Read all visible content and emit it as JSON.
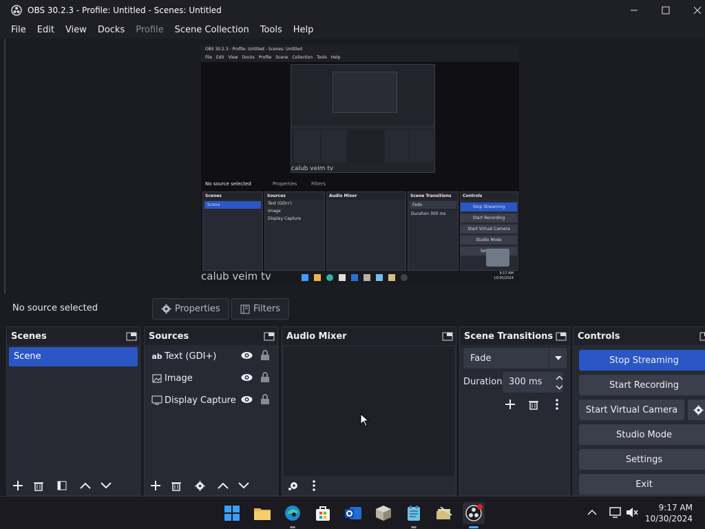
{
  "window": {
    "title": "OBS 30.2.3 - Profile: Untitled - Scenes: Untitled"
  },
  "menu": [
    {
      "label": "File",
      "enabled": true
    },
    {
      "label": "Edit",
      "enabled": true
    },
    {
      "label": "View",
      "enabled": true
    },
    {
      "label": "Docks",
      "enabled": true
    },
    {
      "label": "Profile",
      "enabled": false
    },
    {
      "label": "Scene Collection",
      "enabled": true
    },
    {
      "label": "Tools",
      "enabled": true
    },
    {
      "label": "Help",
      "enabled": true
    }
  ],
  "preview": {
    "caption": "calub veim tv",
    "inner_title": "OBS 30.2.3 - Profile: Untitled - Scenes: Untitled",
    "inner_menu": "File Edit View Docks Profile Scene Collection Tools Help",
    "inner_no_source": "No source selected",
    "inner_properties": "Properties",
    "inner_filters": "Filters",
    "inner_panels": {
      "scenes": "Scenes",
      "sources": "Sources",
      "mixer": "Audio Mixer",
      "transitions": "Scene Transitions",
      "controls": "Controls"
    },
    "inner_scene": "Scene",
    "inner_sources": [
      "Text (GDI+)",
      "Image",
      "Display Capture"
    ],
    "inner_fade": "Fade",
    "inner_duration": "Duration",
    "inner_duration_value": "300 ms",
    "inner_buttons": [
      "Stop Streaming",
      "Start Recording",
      "Start Virtual Camera",
      "Studio Mode",
      "Settings"
    ],
    "inner_clock_time": "9:17 AM",
    "inner_clock_date": "10/30/2024"
  },
  "properties_bar": {
    "status": "No source selected",
    "properties_label": "Properties",
    "filters_label": "Filters"
  },
  "docks": {
    "scenes": {
      "title": "Scenes",
      "items": [
        "Scene"
      ]
    },
    "sources": {
      "title": "Sources",
      "items": [
        {
          "label": "Text (GDI+)",
          "icon": "text-icon"
        },
        {
          "label": "Image",
          "icon": "image-icon"
        },
        {
          "label": "Display Capture",
          "icon": "monitor-icon"
        }
      ]
    },
    "mixer": {
      "title": "Audio Mixer"
    },
    "transitions": {
      "title": "Scene Transitions",
      "selected": "Fade",
      "duration_label": "Duration",
      "duration_value": "300 ms"
    },
    "controls": {
      "title": "Controls",
      "buttons": {
        "stop_streaming": "Stop Streaming",
        "start_recording": "Start Recording",
        "start_virtual_camera": "Start Virtual Camera",
        "studio_mode": "Studio Mode",
        "settings": "Settings",
        "exit": "Exit"
      }
    }
  },
  "taskbar": {
    "apps": [
      "windows-start-icon",
      "file-explorer-icon",
      "edge-icon",
      "microsoft-store-icon",
      "outlook-icon",
      "3d-box-icon",
      "notepad-icon",
      "file-tool-icon",
      "obs-icon"
    ],
    "clock_time": "9:17 AM",
    "clock_date": "10/30/2024"
  },
  "colors": {
    "accent": "#2a56c6",
    "panel": "#272a33",
    "background": "#1b1c22"
  }
}
